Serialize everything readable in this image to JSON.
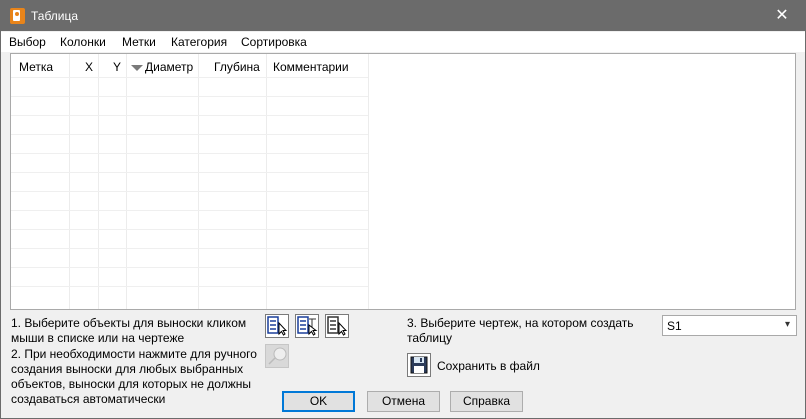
{
  "window": {
    "title": "Таблица"
  },
  "menu": [
    "Выбор",
    "Колонки",
    "Метки",
    "Категория",
    "Сортировка"
  ],
  "table": {
    "columns": [
      "Метка",
      "X",
      "Y",
      "Диаметр",
      "Глубина",
      "Комментарии"
    ],
    "sort_column": "Диаметр",
    "rows": []
  },
  "instructions": {
    "step1": "1. Выберите объекты для выноски кликом мыши в списке или на чертеже",
    "step2": "2. При необходимости нажмите для ручного создания выноски для любых выбранных объектов, выноски для которых не должны создаваться автоматически",
    "step3": "3. Выберите чертеж, на котором создать таблицу"
  },
  "sheet_select": {
    "value": "S1"
  },
  "save": {
    "label": "Сохранить в файл"
  },
  "buttons": {
    "ok": "OK",
    "cancel": "Отмена",
    "help": "Справка"
  },
  "colors": {
    "titlebar": "#6b6b6b",
    "accent": "#0078d7"
  }
}
